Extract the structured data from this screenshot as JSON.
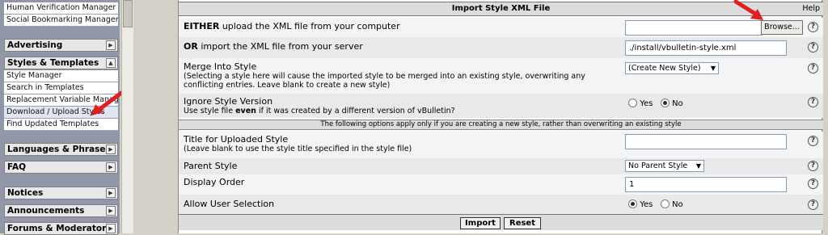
{
  "nav": {
    "top_links": [
      "Human Verification Manager",
      "Social Bookmarking Manager"
    ],
    "groups": {
      "advertising": "Advertising",
      "styles": "Styles & Templates",
      "languages": "Languages & Phrases",
      "faq": "FAQ",
      "notices": "Notices",
      "announcements": "Announcements",
      "forums": "Forums & Moderators"
    },
    "style_links": [
      "Style Manager",
      "Search in Templates",
      "Replacement Variable Manager",
      "Download / Upload Styles",
      "Find Updated Templates"
    ]
  },
  "form": {
    "title": "Import Style XML File",
    "help": "Help",
    "upload": {
      "label_bold": "EITHER",
      "label_rest": "upload the XML file from your computer",
      "browse": "Browse...",
      "value": ""
    },
    "server": {
      "label_bold": "OR",
      "label_rest": "import the XML file from your server",
      "value": "./install/vbulletin-style.xml"
    },
    "merge": {
      "label": "Merge Into Style",
      "desc": "(Selecting a style here will cause the imported style to be merged into an existing style, overwriting any conflicting entries. Leave blank to create a new style)",
      "selected": "(Create New Style)"
    },
    "ignore": {
      "label": "Ignore Style Version",
      "desc_pre": "Use style file",
      "desc_bold": "even",
      "desc_post": "if it was created by a different version of vBulletin?",
      "yes": "Yes",
      "no": "No",
      "value": "No"
    },
    "note": "The following options apply only if you are creating a new style, rather than overwriting an existing style",
    "title_field": {
      "label": "Title for Uploaded Style",
      "desc": "(Leave blank to use the style title specified in the style file)",
      "value": ""
    },
    "parent": {
      "label": "Parent Style",
      "selected": "No Parent Style"
    },
    "order": {
      "label": "Display Order",
      "value": "1"
    },
    "allow": {
      "label": "Allow User Selection",
      "yes": "Yes",
      "no": "No",
      "value": "Yes"
    },
    "buttons": {
      "import": "Import",
      "reset": "Reset"
    },
    "help_glyph": "?"
  },
  "colors": {
    "annotation_arrow": "#e02020",
    "nav_bg": "#8f97a8"
  }
}
